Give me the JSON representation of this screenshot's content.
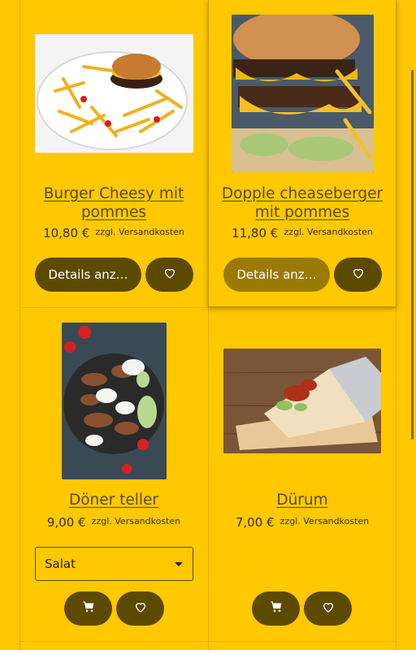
{
  "products": [
    {
      "title_line1": "Burger Cheesy mit",
      "title_line2": "pommes",
      "price": "10,80 €",
      "shipping": "zzgl. Versandkosten",
      "details_label": "Details anz…",
      "image_icon": "burger-with-fries-photo"
    },
    {
      "title_line1": "Dopple cheaseberger",
      "title_line2": "mit pommes",
      "price": "11,80 €",
      "shipping": "zzgl. Versandkosten",
      "details_label": "Details anz…",
      "image_icon": "double-cheeseburger-photo"
    },
    {
      "title": "Döner teller",
      "price": "9,00 €",
      "shipping": "zzgl. Versandkosten",
      "select_value": "Salat",
      "image_icon": "doner-plate-photo"
    },
    {
      "title": "Dürum",
      "price": "7,00 €",
      "shipping": "zzgl. Versandkosten",
      "image_icon": "durum-wrap-photo"
    }
  ],
  "icons": {
    "favorite": "heart-icon",
    "cart": "cart-icon"
  },
  "colors": {
    "background": "#ffc800",
    "button": "#5c4a00",
    "button_hover": "#9a7a00",
    "text": "#3a3000"
  }
}
